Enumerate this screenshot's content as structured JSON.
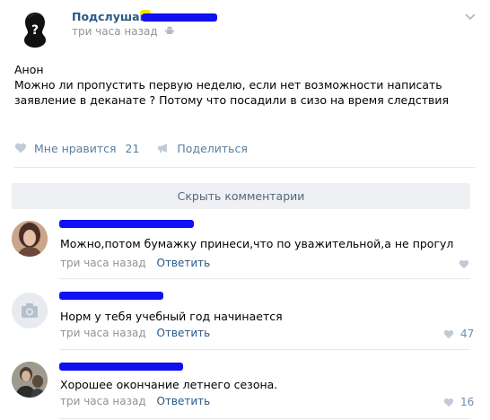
{
  "post": {
    "author": "Подслушано",
    "time": "три часа назад",
    "text_line1": "Анон",
    "text_line2": "Можно ли пропустить первую неделю, если нет возможности написать",
    "text_line3": "заявление в деканате ? Потому что посадили в сизо на время следствия",
    "like_label": "Мне нравится",
    "like_count": "21",
    "share_label": "Поделиться"
  },
  "comments_toggle": "Скрыть комментарии",
  "comments": [
    {
      "text": "Можно,потом бумажку принеси,что по уважительной,а не прогул",
      "time": "три часа назад",
      "reply": "Ответить",
      "likes": ""
    },
    {
      "text": "Норм у тебя учебный год начинается",
      "time": "три часа назад",
      "reply": "Ответить",
      "likes": "47"
    },
    {
      "text": "Хорошее окончание летнего сезона.",
      "time": "три часа назад",
      "reply": "Ответить",
      "likes": "16"
    }
  ],
  "colors": {
    "link": "#2a5885",
    "meta": "#939393",
    "redaction": "#1010f0"
  }
}
